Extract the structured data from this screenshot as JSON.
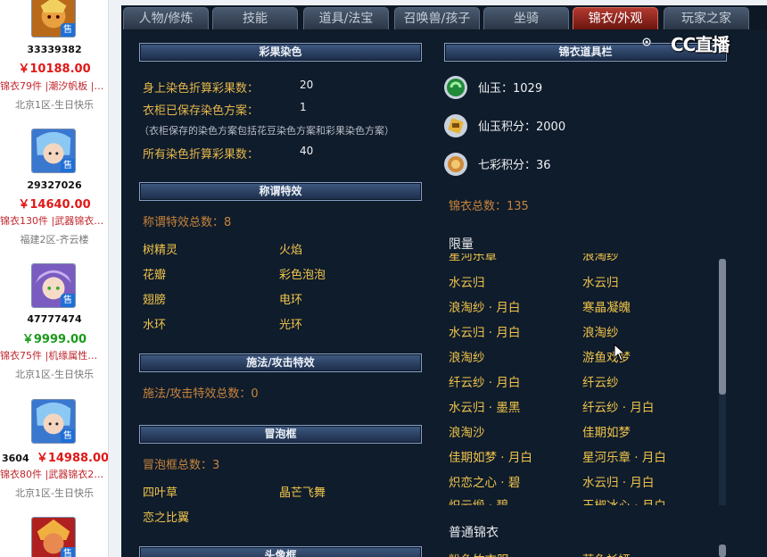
{
  "left_listings": [
    {
      "id": "33339382",
      "price": "￥10188.00",
      "price_color": "red",
      "tags": "锦衣79件 |潮汐帆板 |…",
      "server": "北京1区-生日快乐"
    },
    {
      "id": "29327026",
      "price": "￥14640.00",
      "price_color": "red",
      "tags": "锦衣130件 |武器锦衣…",
      "server": "福建2区-齐云楼"
    },
    {
      "id": "47777474",
      "price": "￥9999.00",
      "price_color": "green",
      "tags": "锦衣75件 |机缘属性…",
      "server": "北京1区-生日快乐"
    },
    {
      "id": "3604",
      "price": "￥14988.00",
      "price_color": "red",
      "tags": "锦衣80件 |武器锦衣2…",
      "server": "北京1区-生日快乐"
    }
  ],
  "sold_badge": "售",
  "tabs": [
    {
      "label": "人物/修炼",
      "active": false
    },
    {
      "label": "技能",
      "active": false
    },
    {
      "label": "道具/法宝",
      "active": false
    },
    {
      "label": "召唤兽/孩子",
      "active": false
    },
    {
      "label": "坐骑",
      "active": false
    },
    {
      "label": "锦衣/外观",
      "active": true
    },
    {
      "label": "玩家之家",
      "active": false
    }
  ],
  "watermark": "CC直播",
  "dye": {
    "heading": "彩果染色",
    "body_label": "身上染色折算彩果数：",
    "body_value": "20",
    "wardrobe_label": "衣柜已保存染色方案：",
    "wardrobe_value": "1",
    "note": "（衣柜保存的染色方案包括花豆染色方案和彩果染色方案）",
    "total_label": "所有染色折算彩果数：",
    "total_value": "40"
  },
  "title_effects": {
    "heading": "称谓特效",
    "count_label": "称谓特效总数：8",
    "items": [
      "树精灵",
      "火焰",
      "花瓣",
      "彩色泡泡",
      "翅膀",
      "电环",
      "水环",
      "光环"
    ]
  },
  "cast_effects": {
    "heading": "施法/攻击特效",
    "count_label": "施法/攻击特效总数：0"
  },
  "bubble": {
    "heading": "冒泡框",
    "count_label": "冒泡框总数：3",
    "items": [
      "四叶草",
      "晶芒飞舞",
      "恋之比翼"
    ]
  },
  "avatar_frame": {
    "heading": "头像框"
  },
  "jinyi_items": {
    "heading": "锦衣道具栏",
    "xianyu_label": "仙玉：1029",
    "xianyu_points_label": "仙玉积分：2000",
    "qicai_points_label": "七彩积分：36",
    "total_label": "锦衣总数：135"
  },
  "limited": {
    "heading": "限量",
    "partial_top": [
      "星河乐章",
      "浪淘纱"
    ],
    "rows": [
      [
        "水云归",
        "水云归"
      ],
      [
        "浪淘纱 · 月白",
        "寒晶凝魄"
      ],
      [
        "水云归 · 月白",
        "浪淘纱"
      ],
      [
        "浪淘纱",
        "游鱼戏梦"
      ],
      [
        "纤云纱 · 月白",
        "纤云纱"
      ],
      [
        "水云归 · 墨黑",
        "纤云纱 · 月白"
      ],
      [
        "浪淘沙",
        "佳期如梦"
      ],
      [
        "佳期如梦 · 月白",
        "星河乐章 · 月白"
      ],
      [
        "炽恋之心 · 碧",
        "水云归 · 月白"
      ]
    ],
    "partial_bottom": [
      "炽云缎 · 碧",
      "玉椒冰心 · 月白"
    ]
  },
  "normal": {
    "heading": "普通锦衣",
    "partial": [
      "粉色竹衣服",
      "萌兔衫娅"
    ]
  }
}
